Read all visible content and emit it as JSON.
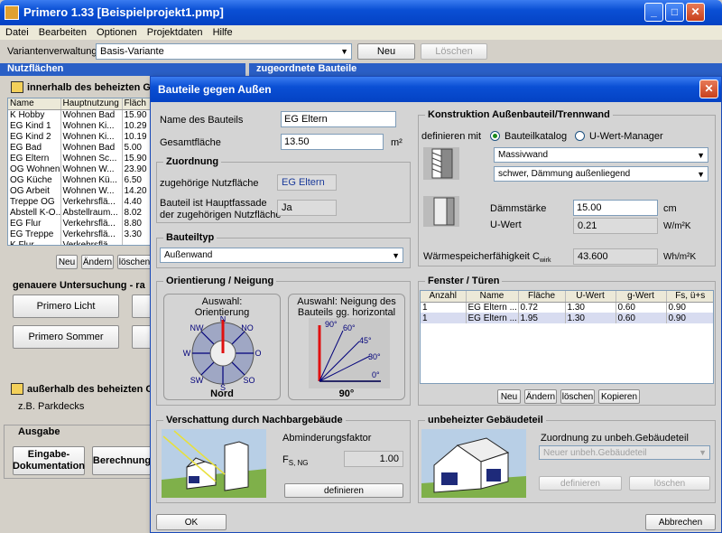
{
  "main": {
    "title": "Primero 1.33  [Beispielprojekt1.pmp]",
    "menu": [
      "Datei",
      "Bearbeiten",
      "Optionen",
      "Projektdaten",
      "Hilfe"
    ],
    "variant_label": "Variantenverwaltung:",
    "variant_value": "Basis-Variante",
    "btn_neu": "Neu",
    "btn_loeschen": "Löschen",
    "nutzflaechen": "Nutzflächen",
    "zugeordnete": "zugeordnete Bauteile",
    "innerhalb": "innerhalb des beheizten G",
    "table_headers": [
      "Name",
      "Hauptnutzung",
      "Fläch"
    ],
    "rows": [
      [
        "K Hobby",
        "Wohnen Bad",
        "15.90"
      ],
      [
        "EG Kind 1",
        "Wohnen Ki...",
        "10.29"
      ],
      [
        "EG Kind 2",
        "Wohnen Ki...",
        "10.19"
      ],
      [
        "EG Bad",
        "Wohnen Bad",
        "5.00"
      ],
      [
        "EG Eltern",
        "Wohnen Sc...",
        "15.90"
      ],
      [
        "OG Wohnen",
        "Wohnen W...",
        "23.90"
      ],
      [
        "OG Küche",
        "Wohnen Kü...",
        "6.50"
      ],
      [
        "OG Arbeit",
        "Wohnen W...",
        "14.20"
      ],
      [
        "Treppe OG",
        "Verkehrsflä...",
        "4.40"
      ],
      [
        "Abstell K-O...",
        "Abstellraum...",
        "8.02"
      ],
      [
        "EG Flur",
        "Verkehrsflä...",
        "8.80"
      ],
      [
        "EG Treppe",
        "Verkehrsflä...",
        "3.30"
      ],
      [
        "K Flur",
        "Verkehrsflä...",
        ""
      ]
    ],
    "row_btns": [
      "Neu",
      "Ändern",
      "löschen"
    ],
    "genauere": "genauere Untersuchung - ra",
    "btn_licht": "Primero Licht",
    "btn_sommer": "Primero Sommer",
    "ausserhalb": "außerhalb des beheizten G",
    "parkdecks": "z.B. Parkdecks",
    "ausgabe": "Ausgabe",
    "btn_eingabe": "Eingabe-\nDokumentation",
    "btn_berechnung": "Berechnung"
  },
  "dialog": {
    "title": "Bauteile gegen Außen",
    "name_label": "Name des Bauteils",
    "name_value": "EG Eltern",
    "flaeche_label": "Gesamtfläche",
    "flaeche_value": "13.50",
    "flaeche_unit": "m²",
    "zuordnung": "Zuordnung",
    "nutzflaeche_label": "zugehörige Nutzfläche",
    "nutzflaeche_value": "EG Eltern",
    "fassade_label": "Bauteil ist Hauptfassade\nder zugehörigen Nutzfläche",
    "fassade_value": "Ja",
    "bauteiltyp": "Bauteiltyp",
    "bauteiltyp_value": "Außenwand",
    "orientierung": "Orientierung / Neigung",
    "auswahl_orient": "Auswahl:\nOrientierung",
    "auswahl_neigung": "Auswahl: Neigung des\nBauteils gg. horizontal",
    "compass": {
      "N": "N",
      "NO": "NO",
      "O": "O",
      "SO": "SO",
      "S": "S",
      "SW": "SW",
      "W": "W",
      "NW": "NW"
    },
    "orient_value": "Nord",
    "neigung_value": "90°",
    "angles": [
      "90°",
      "60°",
      "45°",
      "30°",
      "0°"
    ],
    "verschattung": "Verschattung durch Nachbargebäude",
    "abmind_label": "Abminderungsfaktor",
    "fs_label": "F",
    "fs_sub": "S, NG",
    "fs_value": "1.00",
    "btn_definieren": "definieren",
    "konstruktion": "Konstruktion Außenbauteil/Trennwand",
    "definieren_mit": "definieren mit",
    "radio1": "Bauteilkatalog",
    "radio2": "U-Wert-Manager",
    "sel1": "Massivwand",
    "sel2": "schwer, Dämmung außenliegend",
    "daemm_label": "Dämmstärke",
    "daemm_value": "15.00",
    "daemm_unit": "cm",
    "uwert_label": "U-Wert",
    "uwert_value": "0.21",
    "uwert_unit": "W/m²K",
    "waerme_label": "Wärmespeicherfähigkeit C",
    "waerme_sub": "wirk",
    "waerme_value": "43.600",
    "waerme_unit": "Wh/m²K",
    "fenster": "Fenster / Türen",
    "fenster_headers": [
      "Anzahl",
      "Name",
      "Fläche",
      "U-Wert",
      "g-Wert",
      "Fs, ü+s"
    ],
    "fenster_rows": [
      [
        "1",
        "EG Eltern ...",
        "0.72",
        "1.30",
        "0.60",
        "0.90"
      ],
      [
        "1",
        "EG Eltern ...",
        "1.95",
        "1.30",
        "0.60",
        "0.90"
      ]
    ],
    "fenster_btns": [
      "Neu",
      "Ändern",
      "löschen",
      "Kopieren"
    ],
    "unbeheizt": "unbeheizter Gebäudeteil",
    "zuordnung_unbeh": "Zuordnung zu unbeh.Gebäudeteil",
    "unbeh_sel": "Neuer unbeh.Gebäudeteil",
    "btn_unbeh_def": "definieren",
    "btn_unbeh_del": "löschen",
    "btn_ok": "OK",
    "btn_abbrechen": "Abbrechen"
  }
}
